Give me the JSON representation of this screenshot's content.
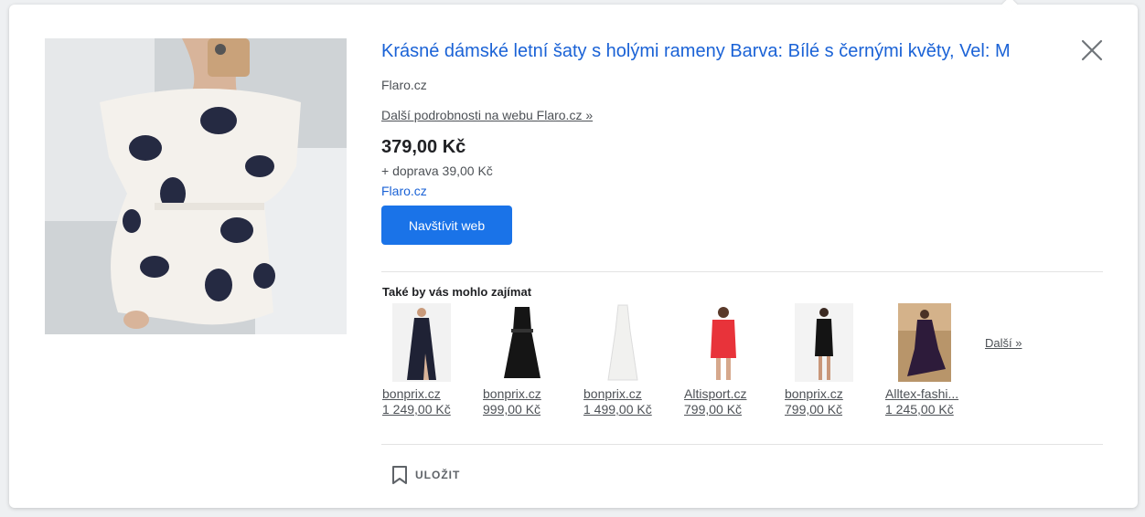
{
  "product": {
    "title": "Krásné dámské letní šaty s holými rameny Barva: Bílé s černými květy, Vel: M",
    "seller": "Flaro.cz",
    "details_link": "Další podrobnosti na webu Flaro.cz »",
    "price": "379,00 Kč",
    "shipping": "+ doprava 39,00 Kč",
    "store_link": "Flaro.cz",
    "visit_button": "Navštívit web"
  },
  "recommendations": {
    "heading": "Také by vás mohlo zajímat",
    "more_link": "Další »",
    "items": [
      {
        "store": "bonprix.cz",
        "price": "1 249,00 Kč"
      },
      {
        "store": "bonprix.cz",
        "price": "999,00 Kč"
      },
      {
        "store": "bonprix.cz",
        "price": "1 499,00 Kč"
      },
      {
        "store": "Altisport.cz",
        "price": "799,00 Kč"
      },
      {
        "store": "bonprix.cz",
        "price": "799,00 Kč"
      },
      {
        "store": "Alltex-fashi...",
        "price": "1 245,00 Kč"
      }
    ]
  },
  "actions": {
    "save_label": "ULOŽIT"
  },
  "icons": {
    "close": "close-icon",
    "save": "bookmark-icon"
  },
  "colors": {
    "link_blue": "#1a62d6",
    "button_blue": "#1a73e8",
    "text_gray": "#4d5156"
  }
}
